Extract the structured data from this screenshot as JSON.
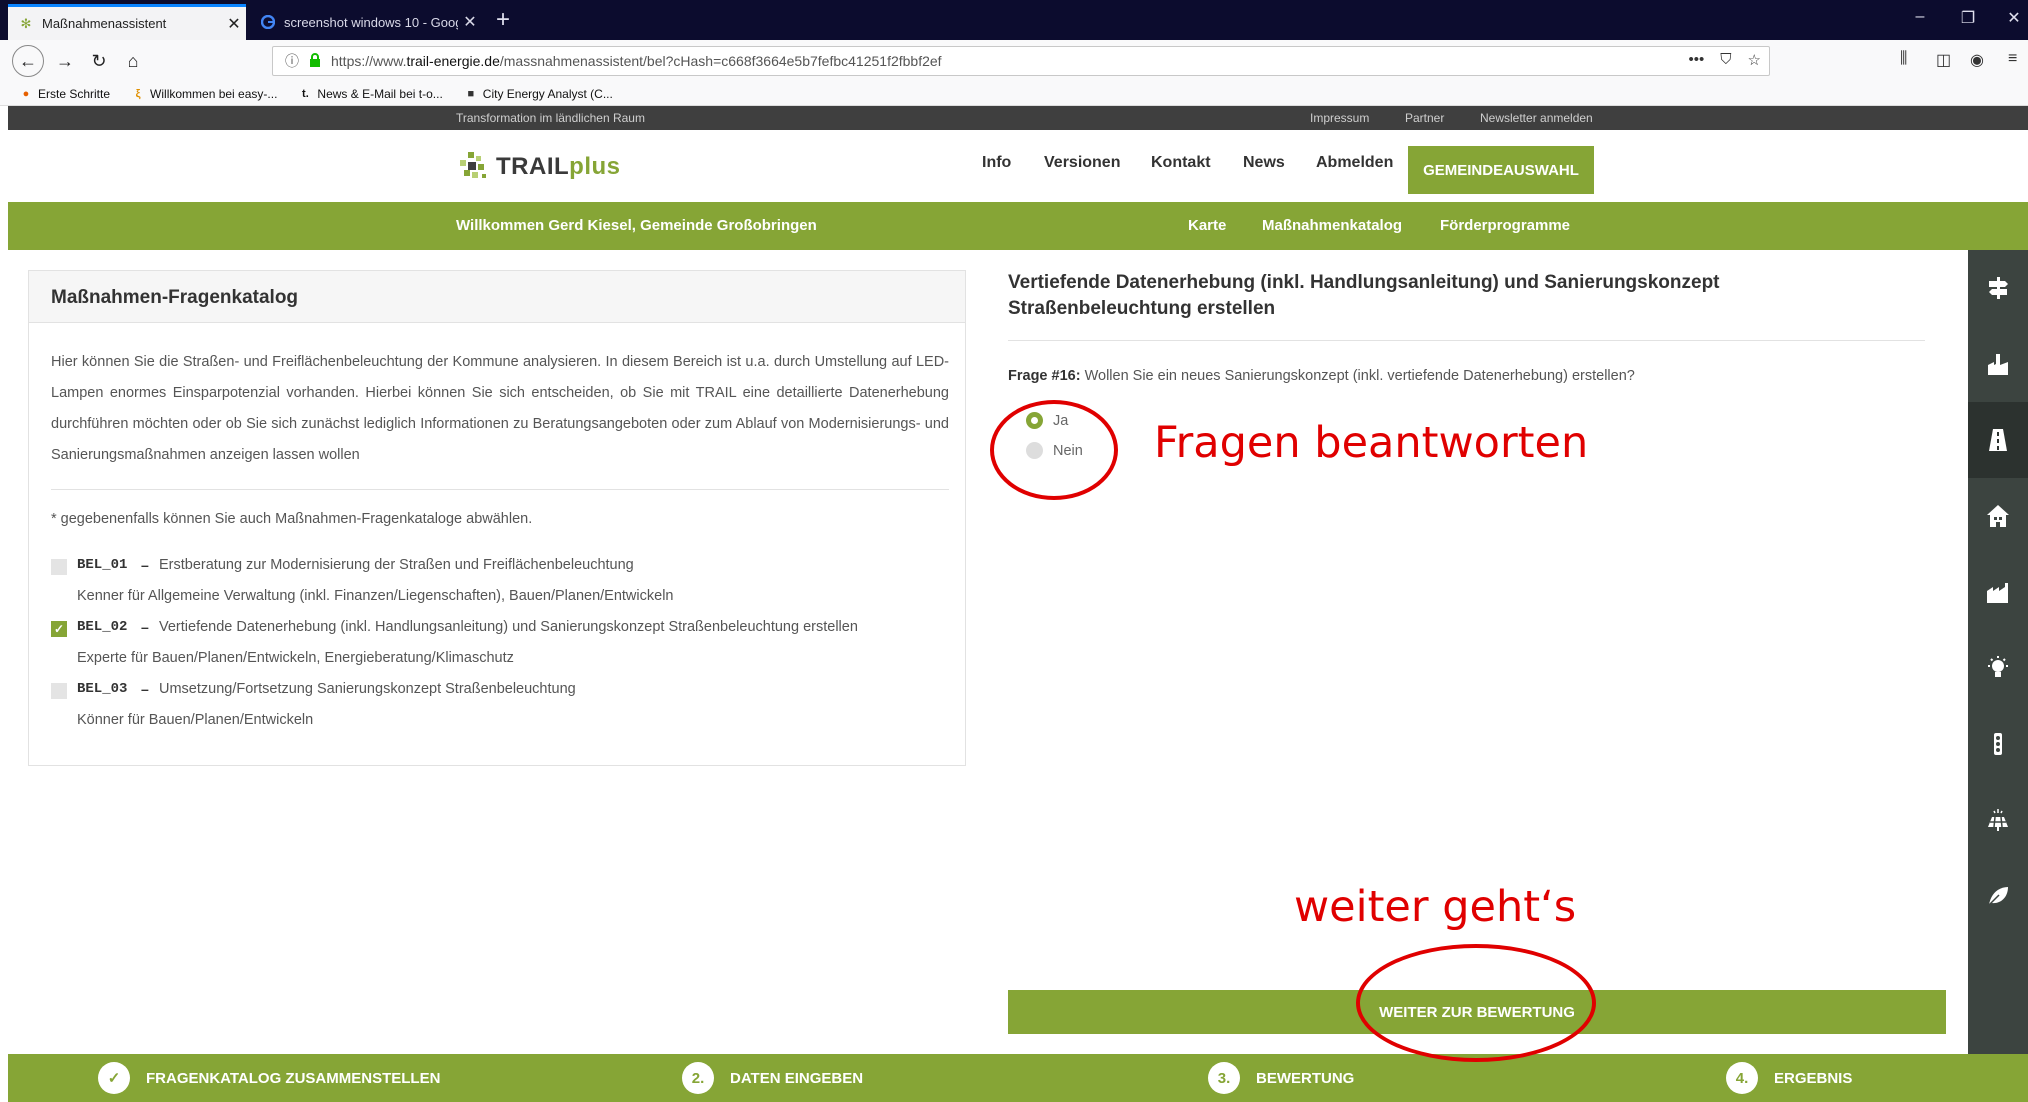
{
  "browser": {
    "tabs": [
      {
        "title": "Maßnahmenassistent",
        "icon": "trail-favicon",
        "active": true
      },
      {
        "title": "screenshot windows 10 - Goog",
        "icon": "google-favicon",
        "active": false
      }
    ],
    "url": {
      "prefix": "https://www.",
      "host": "trail-energie.de",
      "path": "/massnahmenassistent/bel?cHash=c668f3664e5b7fefbc41251f2fbbf2ef"
    },
    "bookmarks": [
      {
        "label": "Erste Schritte",
        "icon": "firefox-icon"
      },
      {
        "label": "Willkommen bei easy-...",
        "icon": "easy-icon"
      },
      {
        "label": "News & E-Mail bei t-o...",
        "icon": "t-online-icon"
      },
      {
        "label": "City Energy Analyst (C...",
        "icon": "cube-icon"
      }
    ]
  },
  "site": {
    "topstrip": {
      "tagline": "Transformation im ländlichen Raum",
      "links": [
        "Impressum",
        "Partner",
        "Newsletter anmelden"
      ]
    },
    "logo": {
      "word": "TRAIL",
      "plus": "plus"
    },
    "nav": [
      "Info",
      "Versionen",
      "Kontakt",
      "News",
      "Abmelden"
    ],
    "nav_button": "GEMEINDEAUSWAHL",
    "greenbar": {
      "welcome": "Willkommen Gerd Kiesel, Gemeinde Großobringen",
      "links": [
        "Karte",
        "Maßnahmenkatalog",
        "Förderprogramme"
      ]
    },
    "catalog": {
      "heading": "Maßnahmen-Fragenkatalog",
      "intro": "Hier können Sie die Straßen- und Freiflächenbeleuchtung der Kommune analysieren. In diesem Bereich ist u.a. durch Umstellung auf LED-Lampen enormes Einsparpotenzial vorhanden. Hierbei können Sie sich entscheiden, ob Sie mit TRAIL eine detaillierte Datenerhebung durchführen möchten oder ob Sie sich zunächst lediglich Informationen zu Beratungsangeboten oder zum Ablauf von Modernisierungs- und Sanierungsmaßnahmen anzeigen lassen wollen",
      "note": "* gegebenenfalls können Sie auch Maßnahmen-Fragenkataloge abwählen.",
      "items": [
        {
          "code": "BEL_01",
          "dash": "–",
          "title": "Erstberatung zur Modernisierung der Straßen und Freiflächenbeleuchtung",
          "sub": "Kenner für Allgemeine Verwaltung (inkl. Finanzen/Liegenschaften), Bauen/Planen/Entwickeln",
          "checked": false
        },
        {
          "code": "BEL_02",
          "dash": "–",
          "title": "Vertiefende Datenerhebung (inkl. Handlungsanleitung) und Sanierungskonzept Straßenbeleuchtung erstellen",
          "sub": "Experte für Bauen/Planen/Entwickeln, Energieberatung/Klimaschutz",
          "checked": true
        },
        {
          "code": "BEL_03",
          "dash": "–",
          "title": "Umsetzung/Fortsetzung Sanierungskonzept Straßenbeleuchtung",
          "sub": "Könner für Bauen/Planen/Entwickeln",
          "checked": false
        }
      ],
      "check_mark": "✓"
    },
    "question_panel": {
      "title": "Vertiefende Datenerhebung (inkl. Handlungsanleitung) und Sanierungskonzept Straßenbeleuchtung erstellen",
      "question_label": "Frage #16:",
      "question_text": " Wollen Sie ein neues Sanierungskonzept (inkl. vertiefende Datenerhebung) erstellen?",
      "options": [
        {
          "label": "Ja",
          "selected": true
        },
        {
          "label": "Nein",
          "selected": false
        }
      ],
      "button": "WEITER ZUR BEWERTUNG"
    },
    "sidebar_icons": [
      "signpost-icon",
      "factory-icon",
      "road-icon",
      "house-icon",
      "industry-icon",
      "lightbulb-icon",
      "traffic-light-icon",
      "solar-panel-icon",
      "leaf-icon"
    ],
    "sidebar_active": "road-icon",
    "steps": [
      {
        "num": "✓",
        "label": "FRAGENKATALOG ZUSAMMENSTELLEN"
      },
      {
        "num": "2.",
        "label": "DATEN EINGEBEN"
      },
      {
        "num": "3.",
        "label": "BEWERTUNG"
      },
      {
        "num": "4.",
        "label": "ERGEBNIS"
      }
    ]
  },
  "annotations": {
    "answer": "Fragen beantworten",
    "next": "weiter geht‘s",
    "color": "#e00000"
  },
  "colors": {
    "accent": "#86a536",
    "sidebar": "#3c4440",
    "topstrip": "#3f3f3f",
    "tabbar": "#0c0c2e"
  }
}
